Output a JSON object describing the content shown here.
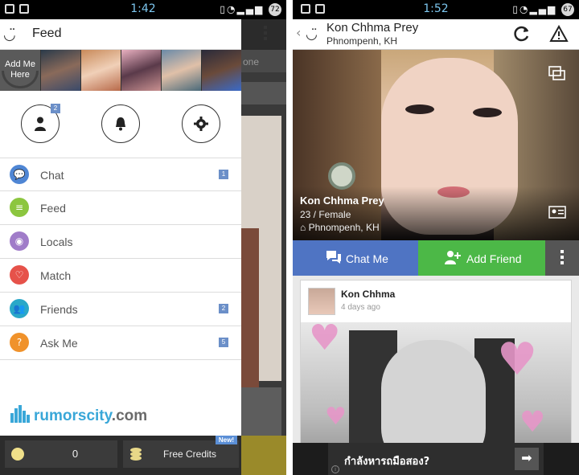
{
  "left": {
    "status": {
      "time": "1:42",
      "battery": "72"
    },
    "header": {
      "logo": "◡̈",
      "title": "Feed"
    },
    "behind_tab": "one",
    "photos": {
      "add_me": "Add Me Here"
    },
    "top_icons": {
      "profile_badge": "2"
    },
    "menu": [
      {
        "label": "Chat",
        "icon": "chat-bubbles-icon",
        "color": "#4f86d4",
        "count": "1"
      },
      {
        "label": "Feed",
        "icon": "feed-list-icon",
        "color": "#8cc63f",
        "count": ""
      },
      {
        "label": "Locals",
        "icon": "location-pin-icon",
        "color": "#a07cc9",
        "count": ""
      },
      {
        "label": "Match",
        "icon": "heart-icon",
        "color": "#e6524a",
        "count": ""
      },
      {
        "label": "Friends",
        "icon": "friends-icon",
        "color": "#2aa8c8",
        "count": "2"
      },
      {
        "label": "Ask Me",
        "icon": "question-icon",
        "color": "#f0922b",
        "count": "5"
      }
    ],
    "brand": {
      "name": "rumorscity",
      "tld": ".com"
    },
    "bottom": {
      "coins": "0",
      "free_credits": "Free Credits",
      "new_tag": "New!"
    }
  },
  "right": {
    "status": {
      "time": "1:52",
      "battery": "67"
    },
    "header": {
      "back": "‹",
      "logo": "◡̈",
      "name": "Kon Chhma Prey",
      "location": "Phnompenh, KH"
    },
    "profile": {
      "name": "Kon Chhma Prey",
      "age_gender": "23 / Female",
      "location": "Phnompenh, KH"
    },
    "actions": {
      "chat": "Chat Me",
      "add_friend": "Add Friend"
    },
    "post": {
      "author": "Kon Chhma",
      "time": "4 days ago"
    },
    "ad": {
      "text": "กำลังหารถมือสอง?",
      "arrow": "➡",
      "info": "i"
    }
  },
  "colors": {
    "blue": "#4f74c3",
    "green": "#4cb847",
    "badge": "#6b8fc8",
    "brand": "#39a7d8"
  }
}
